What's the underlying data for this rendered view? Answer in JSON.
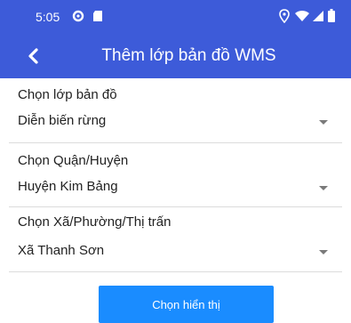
{
  "status_bar": {
    "time": "5:05",
    "icons": [
      "settings-gear-icon",
      "sd-card-icon",
      "location-icon",
      "wifi-icon",
      "signal-icon",
      "battery-icon"
    ]
  },
  "app_bar": {
    "title": "Thêm lớp bản đồ WMS",
    "back_icon": "chevron-left-icon"
  },
  "form": {
    "layer": {
      "label": "Chọn lớp bản đồ",
      "value": "Diễn biến rừng"
    },
    "district": {
      "label": "Chọn Quận/Huyện",
      "value": "Huyện Kim Bảng"
    },
    "commune": {
      "label": "Chọn Xã/Phường/Thị trấn",
      "value": "Xã Thanh Sơn"
    }
  },
  "actions": {
    "show_label": "Chọn hiển thị"
  },
  "colors": {
    "primary": "#3d5bd9",
    "button": "#1a8cff"
  }
}
